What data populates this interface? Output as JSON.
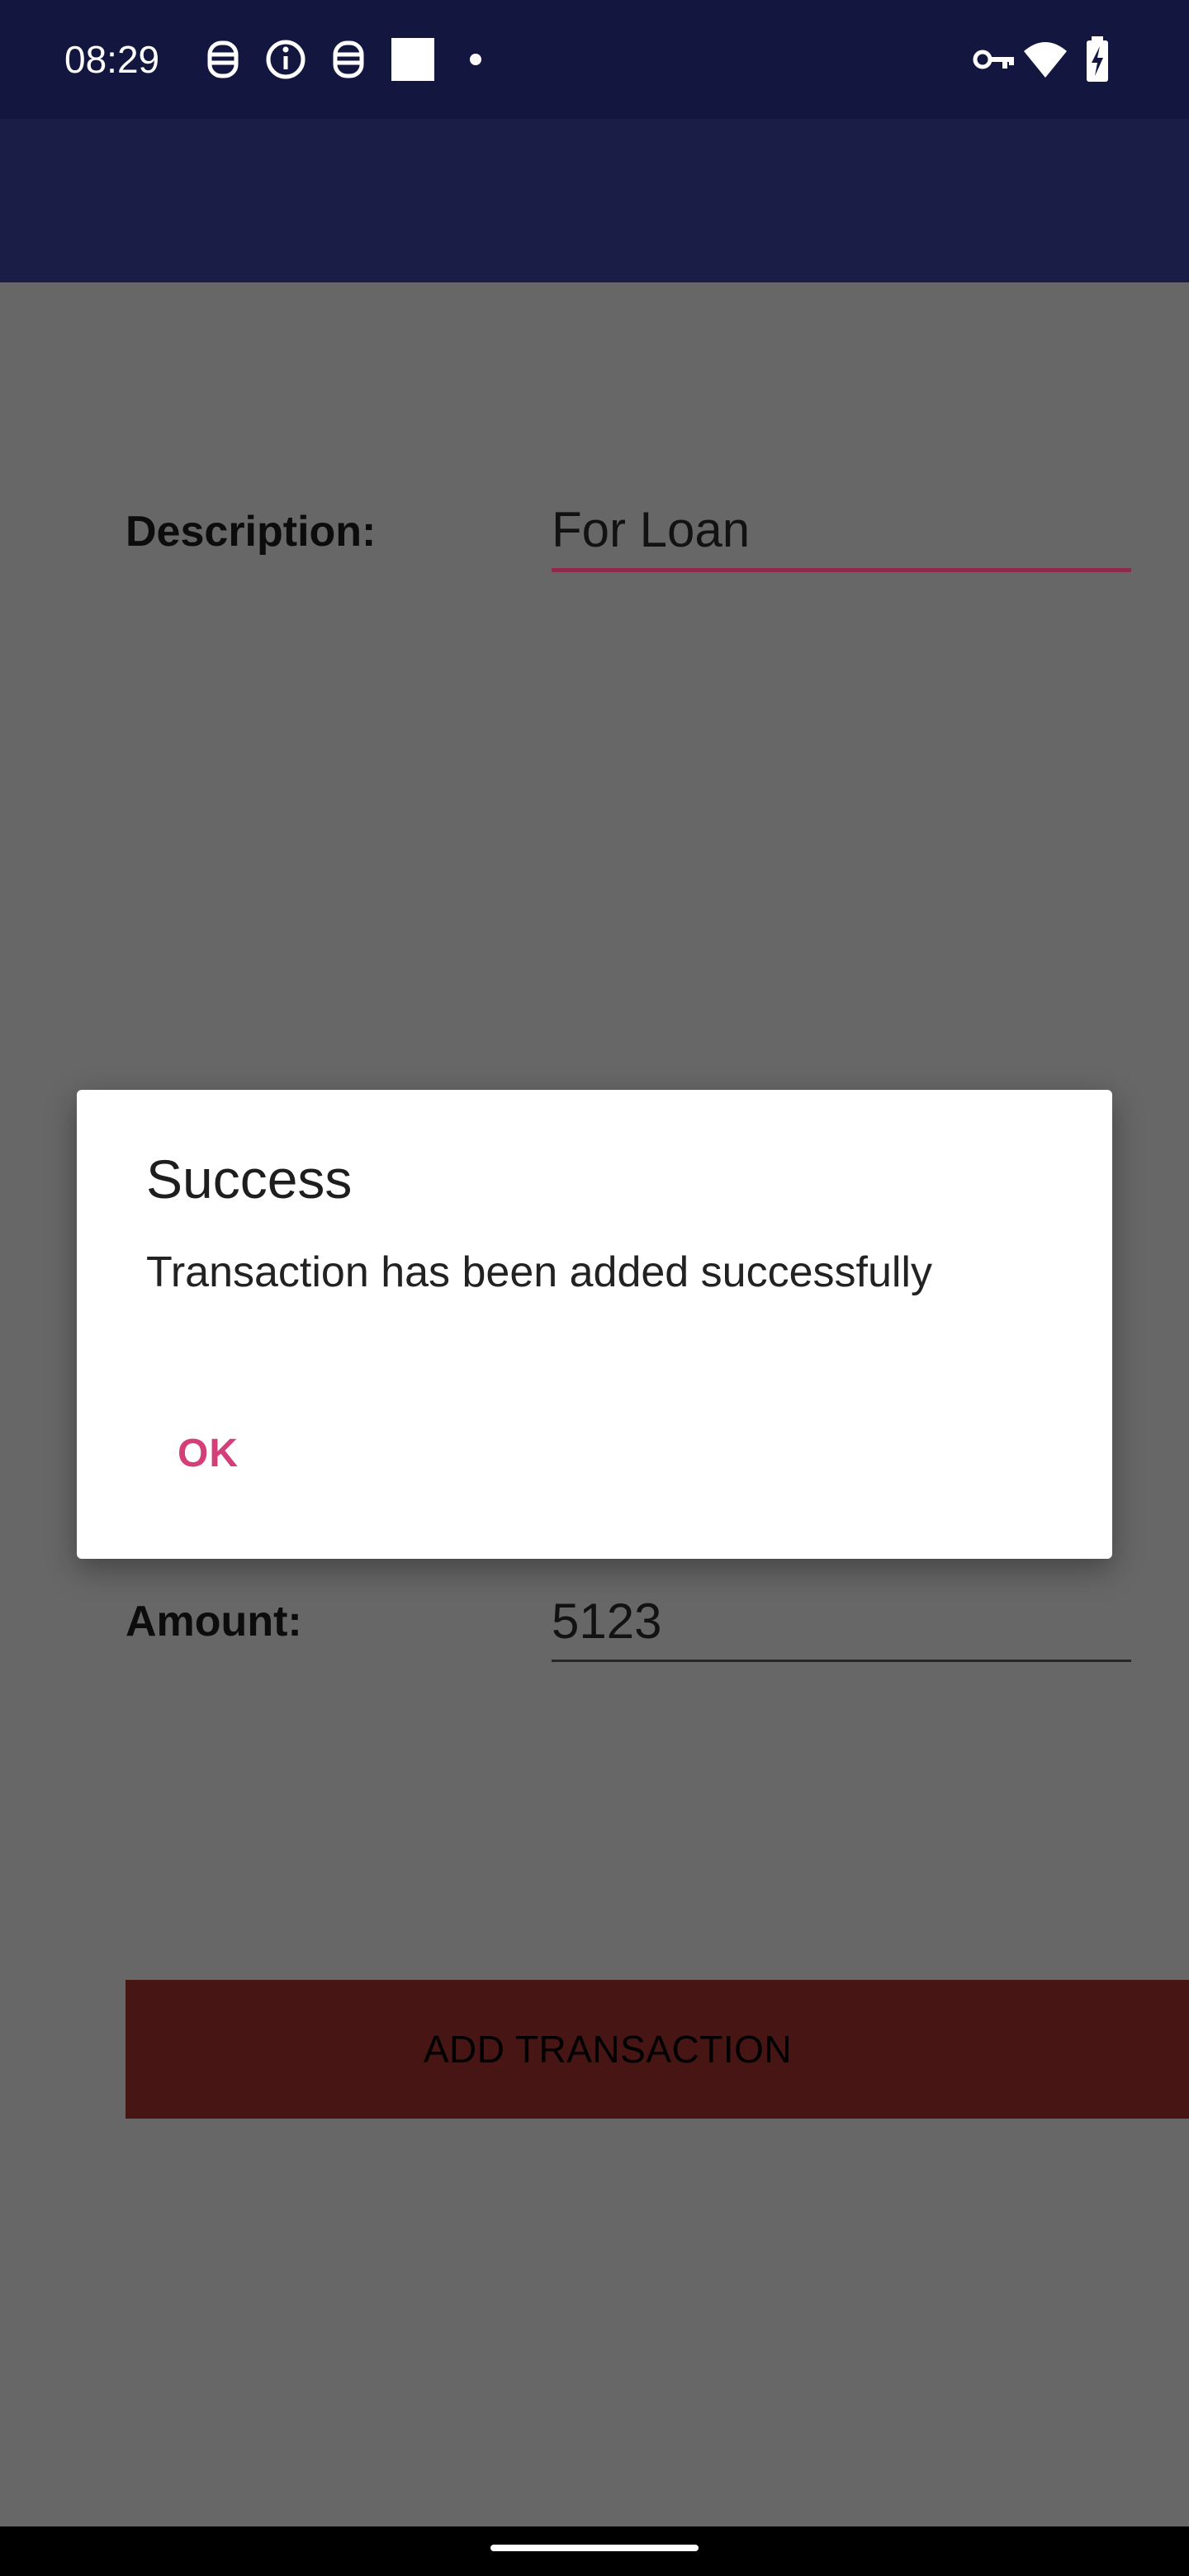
{
  "status_bar": {
    "time": "08:29",
    "left_icons": [
      "app-notification-icon",
      "info-icon",
      "app-notification-icon",
      "square-notification-icon",
      "dot-icon"
    ],
    "right_icons": [
      "vpn-key-icon",
      "wifi-icon",
      "battery-charging-icon"
    ]
  },
  "form": {
    "description_label": "Description:",
    "description_value": "For Loan",
    "amount_label": "Amount:",
    "amount_value": "5123",
    "submit_label": "ADD TRANSACTION"
  },
  "dialog": {
    "title": "Success",
    "message": "Transaction has been added successfully",
    "ok_label": "OK"
  },
  "colors": {
    "status_bar": "#131740",
    "app_bar": "#1a1e46",
    "scrim_background": "#676767",
    "focused_underline": "#8e2a4a",
    "button_background": "#471514",
    "dialog_accent": "#d43f7a"
  }
}
